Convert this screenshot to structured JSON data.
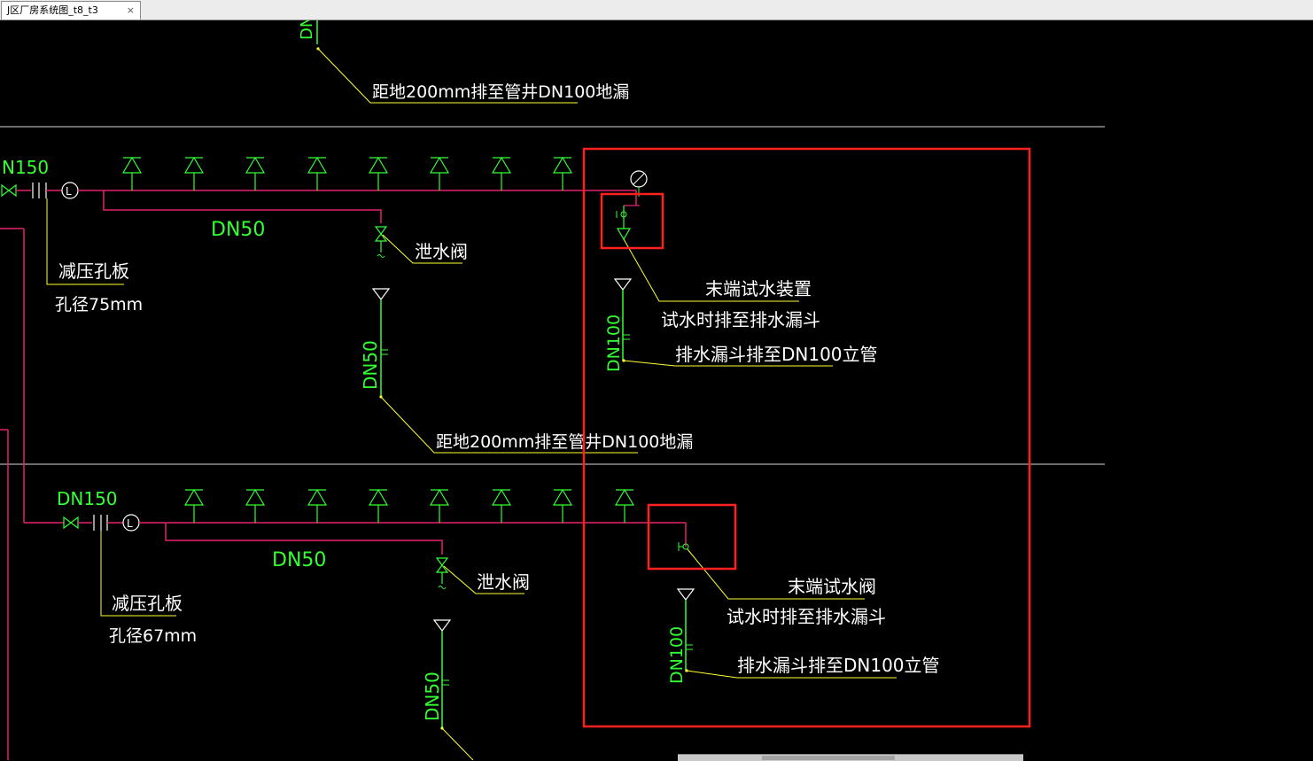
{
  "tab": {
    "title": "J区厂房系统图_t8_t3",
    "close_glyph": "×"
  },
  "drawing": {
    "colors": {
      "background": "#000000",
      "pipe": "#e0236c",
      "text": "#ffffff",
      "green": "#33ff33",
      "leader": "#ffff33",
      "highlight": "#ff2020"
    },
    "top": {
      "riser_label": "DN",
      "drain_note": "距地200mm排至管井DN100地漏"
    },
    "floor_upper": {
      "main_size": "N150",
      "branch_size": "DN50",
      "flow_switch": "L",
      "orifice_label": "减压孔板",
      "orifice_diameter": "孔径75mm",
      "drain_valve": "泄水阀",
      "riser_size": "DN50",
      "drain_note": "距地200mm排至管井DN100地漏",
      "end_device": "末端试水装置",
      "test_note": "试水时排至排水漏斗",
      "funnel_riser_size": "DN100",
      "funnel_note": "排水漏斗排至DN100立管"
    },
    "floor_lower": {
      "main_size": "DN150",
      "branch_size": "DN50",
      "flow_switch": "L",
      "orifice_label": "减压孔板",
      "orifice_diameter": "孔径67mm",
      "drain_valve": "泄水阀",
      "riser_size": "DN50",
      "end_device": "末端试水阀",
      "test_note": "试水时排至排水漏斗",
      "funnel_riser_size": "DN100",
      "funnel_note": "排水漏斗排至DN100立管"
    }
  }
}
